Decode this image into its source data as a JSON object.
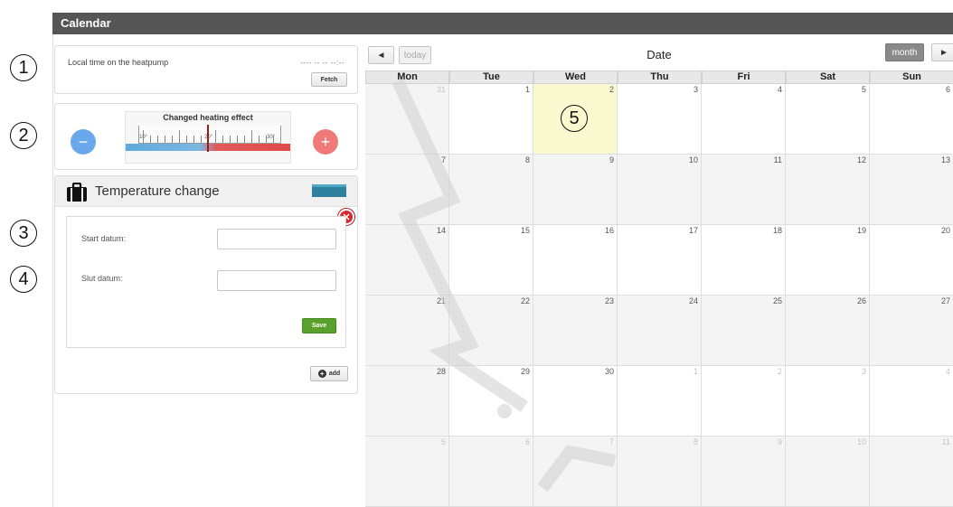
{
  "titlebar": {
    "title": "Calendar"
  },
  "callouts": [
    "1",
    "2",
    "3",
    "4",
    "5"
  ],
  "time_panel": {
    "label": "Local time on the heatpump",
    "value": "---- -- -- --:--",
    "fetch_label": "Fetch"
  },
  "heating_panel": {
    "title": "Changed heating effect",
    "minus_symbol": "−",
    "plus_symbol": "+",
    "tick_labels": [
      "10°",
      "20°",
      "30°"
    ],
    "colors": {
      "minus": "#6aa8ec",
      "plus": "#f07a7a"
    }
  },
  "temp_panel": {
    "title": "Temperature change",
    "start_label": "Start datum:",
    "end_label": "Slut datum:",
    "start_value": "",
    "end_value": "",
    "save_label": "Save",
    "add_label": "add",
    "close_symbol": "✕",
    "swatch_color": "#2f7f9e"
  },
  "calendar": {
    "title": "Date",
    "today_label": "today",
    "month_label": "month",
    "prev_symbol": "◄",
    "next_symbol": "►",
    "weekdays": [
      "Mon",
      "Tue",
      "Wed",
      "Thu",
      "Fri",
      "Sat",
      "Sun"
    ],
    "weeks": [
      [
        "31",
        "1",
        "2",
        "3",
        "4",
        "5",
        "6"
      ],
      [
        "7",
        "8",
        "9",
        "10",
        "11",
        "12",
        "13"
      ],
      [
        "14",
        "15",
        "16",
        "17",
        "18",
        "19",
        "20"
      ],
      [
        "21",
        "22",
        "23",
        "24",
        "25",
        "26",
        "27"
      ],
      [
        "28",
        "29",
        "30",
        "1",
        "2",
        "3",
        "4"
      ],
      [
        "5",
        "6",
        "7",
        "8",
        "9",
        "10",
        "11"
      ]
    ],
    "today_index": [
      0,
      2
    ],
    "colors": {
      "today": "#fbf9cf",
      "other_month": "#f4f4f4"
    }
  }
}
